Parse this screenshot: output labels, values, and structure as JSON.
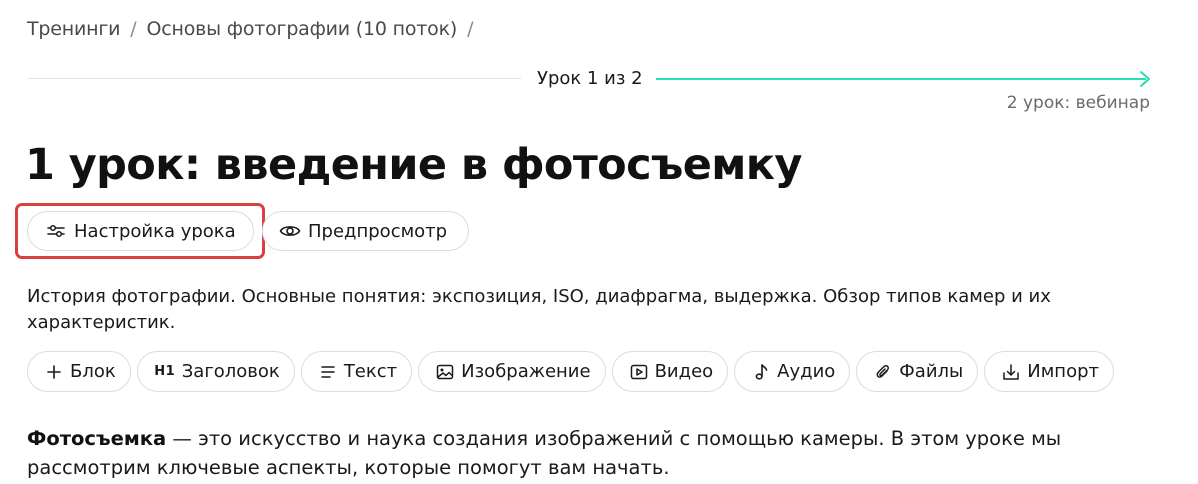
{
  "breadcrumb": {
    "items": [
      "Тренинги",
      "Основы фотографии (10 поток)"
    ],
    "separator": "/"
  },
  "progress": {
    "label": "Урок 1 из 2",
    "next_label": "2 урок: вебинар",
    "accent_color": "#27dfb3"
  },
  "lesson": {
    "title": "1 урок: введение в фотосъемку",
    "description": "История фотографии. Основные понятия: экспозиция, ISO, диафрагма, выдержка. Обзор типов камер и их характеристик."
  },
  "actions": {
    "settings_label": "Настройка урока",
    "settings_icon": "sliders-icon",
    "preview_label": "Предпросмотр",
    "preview_icon": "eye-icon",
    "highlight_color": "#d94040"
  },
  "toolbar": {
    "block": {
      "label": "Блок",
      "icon": "plus-icon"
    },
    "heading": {
      "label": "Заголовок",
      "icon": "h1-icon",
      "icon_text": "H1"
    },
    "text": {
      "label": "Текст",
      "icon": "text-lines-icon"
    },
    "image": {
      "label": "Изображение",
      "icon": "image-icon"
    },
    "video": {
      "label": "Видео",
      "icon": "video-play-icon"
    },
    "audio": {
      "label": "Аудио",
      "icon": "music-note-icon"
    },
    "files": {
      "label": "Файлы",
      "icon": "paperclip-icon"
    },
    "import": {
      "label": "Импорт",
      "icon": "download-icon"
    }
  },
  "content": {
    "intro_bold": "Фотосъемка",
    "intro_rest": " — это искусство и наука создания изображений с помощью камеры. В этом уроке мы рассмотрим ключевые аспекты, которые помогут вам начать."
  }
}
